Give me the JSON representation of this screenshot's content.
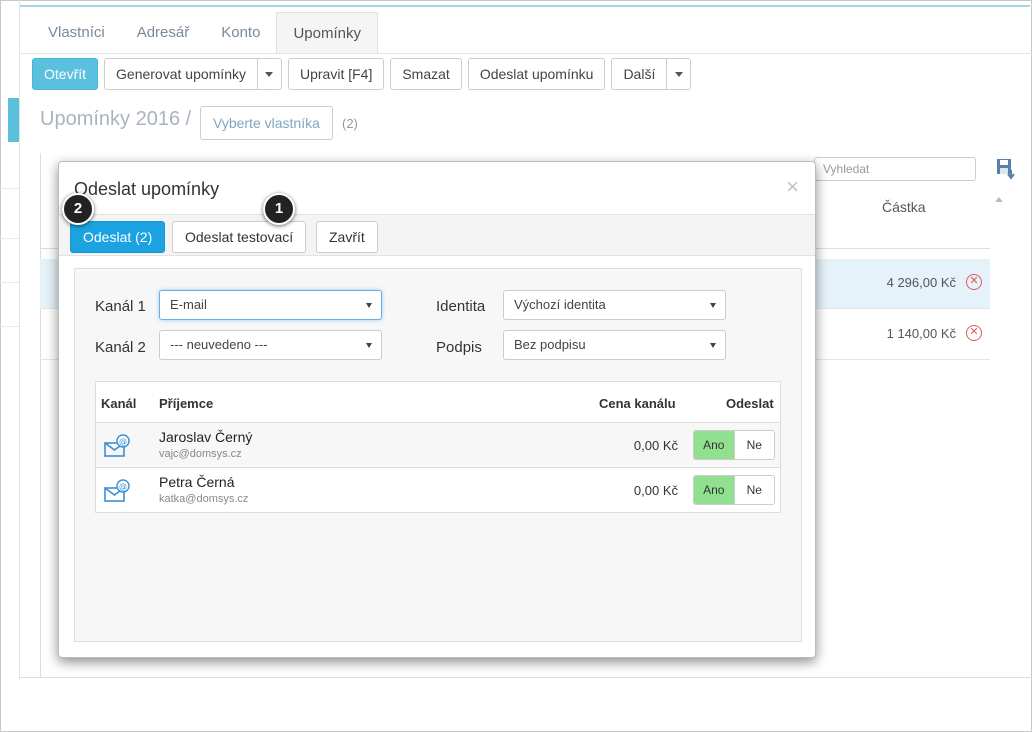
{
  "tabs": [
    {
      "label": "Vlastníci"
    },
    {
      "label": "Adresář"
    },
    {
      "label": "Konto"
    },
    {
      "label": "Upomínky"
    }
  ],
  "toolbar": {
    "open": "Otevřít",
    "generate": "Generovat upomínky",
    "edit": "Upravit [F4]",
    "delete": "Smazat",
    "send": "Odeslat upomínku",
    "more": "Další"
  },
  "page": {
    "title": "Upomínky 2016 /",
    "owner_button": "Vyberte vlastníka",
    "count": "(2)"
  },
  "grid": {
    "search_placeholder": "Vyhledat",
    "amount_header": "Částka",
    "rows": [
      {
        "amount": "4 296,00 Kč"
      },
      {
        "amount": "1 140,00 Kč"
      }
    ]
  },
  "modal": {
    "title": "Odeslat upomínky",
    "send_button": "Odeslat (2)",
    "test_button": "Odeslat testovací",
    "close_button": "Zavřít",
    "badge_send": "2",
    "badge_test": "1",
    "channel1_label": "Kanál 1",
    "channel1_value": "E-mail",
    "channel2_label": "Kanál 2",
    "channel2_value": "--- neuvedeno ---",
    "identity_label": "Identita",
    "identity_value": "Výchozí identita",
    "signature_label": "Podpis",
    "signature_value": "Bez podpisu",
    "table": {
      "headers": {
        "channel": "Kanál",
        "recipient": "Příjemce",
        "price": "Cena kanálu",
        "send": "Odeslat"
      },
      "rows": [
        {
          "name": "Jaroslav Černý",
          "email": "vajc@domsys.cz",
          "price": "0,00 Kč",
          "yes": "Ano",
          "no": "Ne"
        },
        {
          "name": "Petra Černá",
          "email": "katka@domsys.cz",
          "price": "0,00 Kč",
          "yes": "Ano",
          "no": "Ne"
        }
      ]
    }
  },
  "colors": {
    "accent": "#5bc0de",
    "primary": "#1aa3e0",
    "toggle_on": "#90e090",
    "danger": "#e05a5a"
  }
}
